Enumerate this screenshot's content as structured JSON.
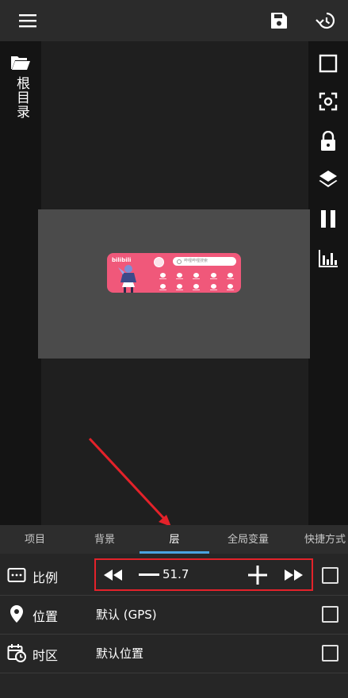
{
  "topbar": {
    "menu_icon": "menu-icon",
    "save_icon": "save-icon",
    "history_icon": "history-icon"
  },
  "sidebar_left": {
    "folder_icon": "folder-open-icon",
    "root_label": "根目录"
  },
  "toolbar_right": {
    "icons": [
      "square-outline-icon",
      "focus-icon",
      "lock-icon",
      "layers-icon",
      "pause-icon",
      "bar-chart-icon"
    ]
  },
  "widget_preview": {
    "logo_text": "bilibili",
    "search_placeholder": "哔哩哔哩搜索"
  },
  "tabs": [
    {
      "label": "项目"
    },
    {
      "label": "背景"
    },
    {
      "label": "层"
    },
    {
      "label": "全局变量"
    },
    {
      "label": "快捷方式"
    }
  ],
  "active_tab": "层",
  "rows": {
    "scale": {
      "label": "比例",
      "value": "51.7",
      "icon": "scale-icon"
    },
    "position": {
      "label": "位置",
      "value": "默认 (GPS)",
      "icon": "location-pin-icon"
    },
    "timezone": {
      "label": "时区",
      "value": "默认位置",
      "icon": "calendar-clock-icon"
    }
  },
  "colors": {
    "accent": "#4aa3df",
    "highlight": "#e3222a",
    "widget_pink": "#f0587a"
  }
}
